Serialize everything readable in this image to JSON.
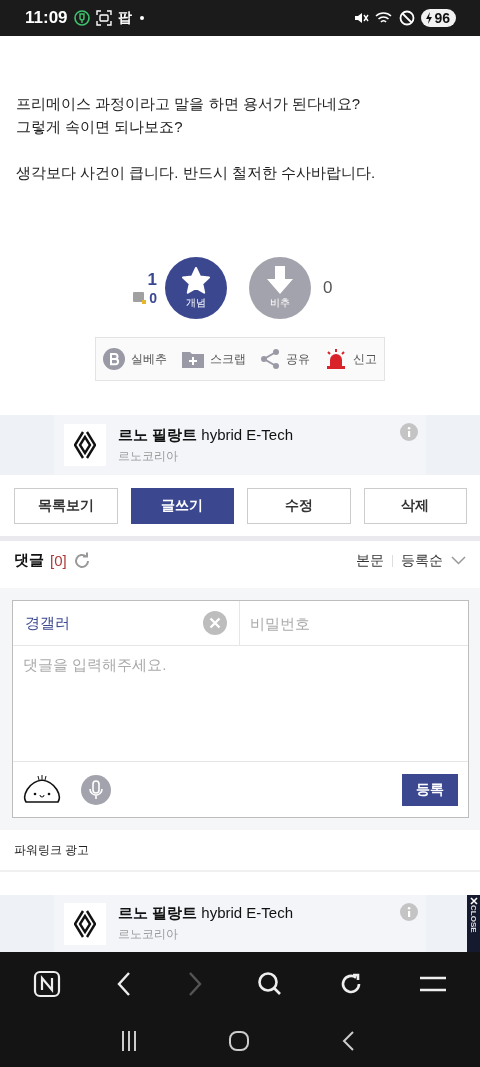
{
  "status_bar": {
    "time": "11:09",
    "notification_text": "팝",
    "battery": "96"
  },
  "post": {
    "paragraphs": [
      [
        "프리메이스 과정이라고 말을 하면 용서가 된다네요?",
        "그렇게 속이면 되나보죠?"
      ],
      [
        "생각보다 사건이 큽니다. 반드시 철저한 수사바랍니다."
      ]
    ]
  },
  "vote": {
    "up_count": "1",
    "fixed_count": "0",
    "up_label": "개념",
    "down_label": "비추",
    "down_count": "0"
  },
  "actions": [
    {
      "kind": "best",
      "label": "실베추"
    },
    {
      "kind": "scrap",
      "label": "스크랩"
    },
    {
      "kind": "share",
      "label": "공유"
    },
    {
      "kind": "report",
      "label": "신고"
    }
  ],
  "ad_top": {
    "title": "**르노 필랑트** hybrid E-Tech",
    "advertiser": "르노코리아"
  },
  "board_buttons": [
    {
      "label": "목록보기",
      "primary": false
    },
    {
      "label": "글쓰기",
      "primary": true
    },
    {
      "label": "수정",
      "primary": false
    },
    {
      "label": "삭제",
      "primary": false
    }
  ],
  "comments": {
    "title": "댓글",
    "count": "[0]",
    "sort_options": [
      "본문",
      "등록순"
    ]
  },
  "comment_form": {
    "nickname": "경갤러",
    "password_placeholder": "비밀번호",
    "comment_placeholder": "댓글을 입력해주세요.",
    "submit": "등록"
  },
  "powerlink": {
    "title": "파워링크 광고"
  },
  "ad_bottom": {
    "title": "**르노 필랑트** hybrid E-Tech",
    "advertiser": "르노코리아",
    "close": "CLOSE"
  },
  "browser_toolbar": [
    {
      "kind": "home",
      "disabled": false
    },
    {
      "kind": "back",
      "disabled": false
    },
    {
      "kind": "forward",
      "disabled": true
    },
    {
      "kind": "search",
      "disabled": false
    },
    {
      "kind": "reload",
      "disabled": false
    },
    {
      "kind": "menu",
      "disabled": false
    }
  ],
  "nav_bar": [
    {
      "kind": "recents"
    },
    {
      "kind": "home"
    },
    {
      "kind": "back"
    }
  ]
}
